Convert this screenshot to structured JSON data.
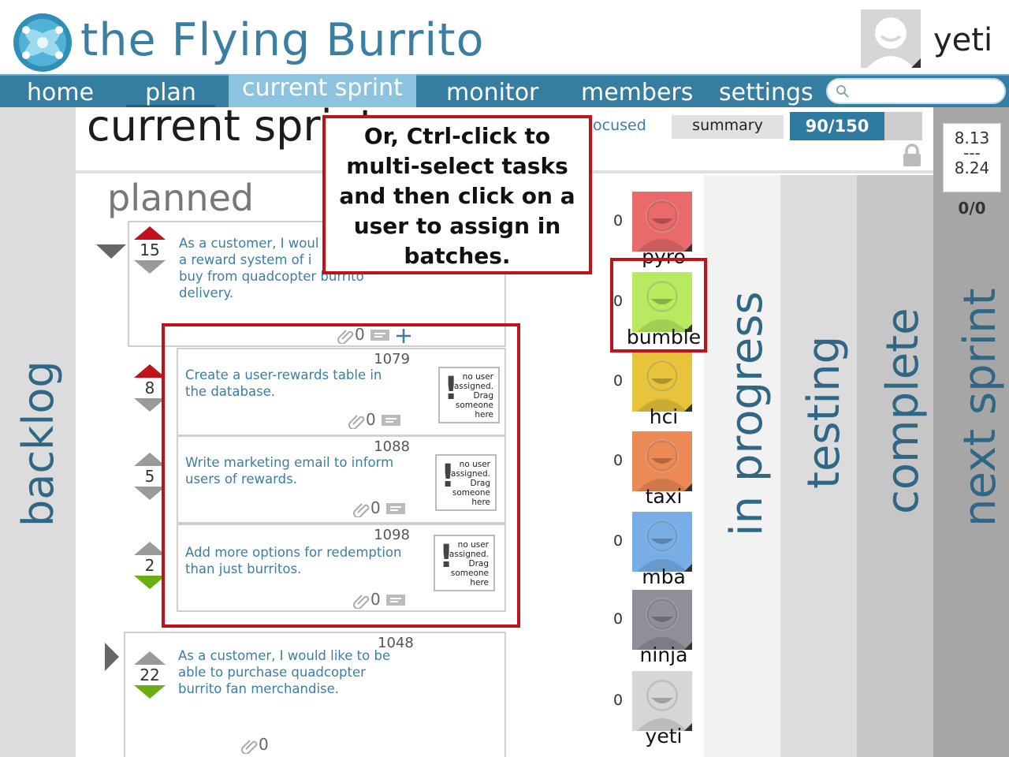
{
  "app": {
    "title": "the Flying Burrito",
    "user": "yeti"
  },
  "nav": {
    "home": "home",
    "plan": "plan",
    "current_sprint": "current sprint",
    "monitor": "monitor",
    "members": "members",
    "settings": "settings",
    "search_placeholder": ""
  },
  "sprint": {
    "title": "current sprint",
    "focused_label": "ocused",
    "summary_label": "summary",
    "points": "90/150",
    "dates": {
      "start": "8.13",
      "sep": "---",
      "end": "8.24"
    },
    "count": "0/0"
  },
  "columns": {
    "backlog": "backlog",
    "in_progress": "in progress",
    "testing": "testing",
    "complete": "complete",
    "next_sprint": "next sprint"
  },
  "planned": {
    "title": "planned",
    "stories": [
      {
        "votes": "15",
        "text": "As a customer, I woul\na reward system of  i\nbuy from quadcopter burrito\ndelivery.",
        "attachments": "0"
      },
      {
        "id": "1048",
        "votes": "22",
        "text": "As a customer, I would like to be\nable to purchase quadcopter\nburrito fan merchandise.",
        "attachments": "0"
      }
    ],
    "tasks": [
      {
        "id": "1079",
        "votes": "8",
        "text": "Create a user-rewards table in\nthe database.",
        "attachments": "0"
      },
      {
        "id": "1088",
        "votes": "5",
        "text": "Write marketing email to inform\nusers of  rewards.",
        "attachments": "0"
      },
      {
        "id": "1098",
        "votes": "2",
        "text": "Add more options for redemption\nthan just burritos.",
        "attachments": "0"
      }
    ],
    "no_user_text": "no user\nassigned.\nDrag\nsomeone\nhere"
  },
  "members": [
    {
      "name": "pyro",
      "count": "0",
      "color": "#e86a6a"
    },
    {
      "name": "bumble",
      "count": "0",
      "color": "#b7ea5f"
    },
    {
      "name": "hci",
      "count": "0",
      "color": "#e7c43a"
    },
    {
      "name": "taxi",
      "count": "0",
      "color": "#ec8a55"
    },
    {
      "name": "mba",
      "count": "0",
      "color": "#78aee6"
    },
    {
      "name": "ninja",
      "count": "0",
      "color": "#8e8f97"
    },
    {
      "name": "yeti",
      "count": "0",
      "color": "#d6d6d6"
    }
  ],
  "tooltip": "Or, Ctrl-click to\nmulti-select tasks\nand then click on a\nuser to assign in\nbatches.",
  "colors": {
    "accent": "#357da1",
    "highlight": "#c0121b",
    "vote_up": "#c0121b",
    "vote_down": "#6aae14"
  }
}
